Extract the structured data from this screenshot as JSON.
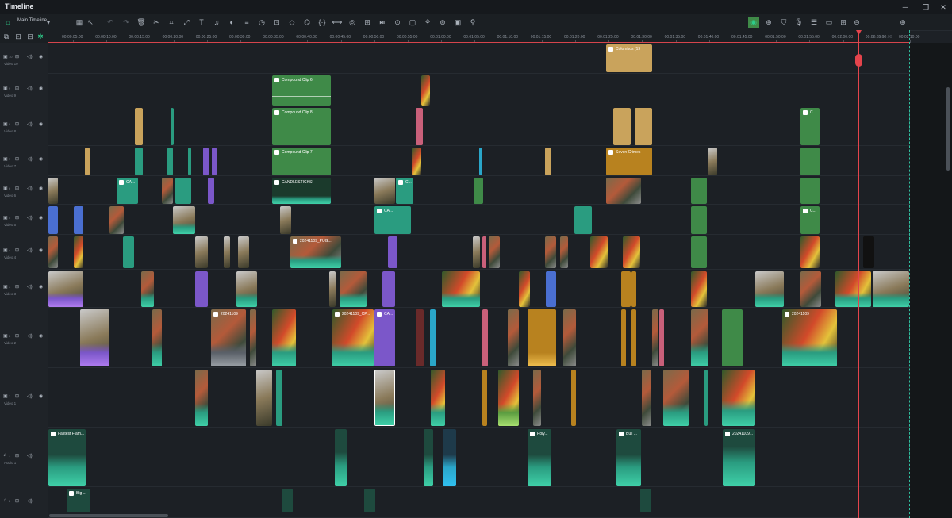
{
  "window": {
    "title": "Timeline"
  },
  "toolbar": {
    "timeline_name": "Main Timeline"
  },
  "ruler": {
    "ticks": [
      "00:00:05:00",
      "00:00:10:00",
      "00:00:15:00",
      "00:00:20:00",
      "00:00:25:00",
      "00:00:30:00",
      "00:00:35:00",
      "00:00:40:00",
      "00:00:45:00",
      "00:00:50:00",
      "00:00:55:00",
      "00:01:00:00",
      "00:01:05:00",
      "00:01:10:00",
      "00:01:15:00",
      "00:01:20:00",
      "00:01:25:00",
      "00:01:30:00",
      "00:01:35:00",
      "00:01:40:00",
      "00:01:45:00",
      "00:01:50:00",
      "00:01:55:00",
      "00:02:00:00",
      "00:02:05:00",
      "00:02:10:00"
    ],
    "end_label": "00:02:15:00"
  },
  "tracks": [
    {
      "num": "10",
      "name": "Video 10"
    },
    {
      "num": "9",
      "name": "Video 9"
    },
    {
      "num": "8",
      "name": "Video 8"
    },
    {
      "num": "7",
      "name": "Video 7"
    },
    {
      "num": "6",
      "name": "Video 6"
    },
    {
      "num": "5",
      "name": "Video 5"
    },
    {
      "num": "4",
      "name": "Video 4"
    },
    {
      "num": "3",
      "name": "Video 3"
    },
    {
      "num": "2",
      "name": "Video 2"
    },
    {
      "num": "1",
      "name": "Video 1"
    },
    {
      "num": "1",
      "name": "Audio 1"
    },
    {
      "num": "2",
      "name": ""
    }
  ],
  "clips": {
    "colombus": "Colombus (19",
    "compound6": "Compound Clip 6",
    "compound8": "Compound Clip 8",
    "compound7": "Compound Clip 7",
    "seven_crimes": "Seven Crimes",
    "candlesticks": "CANDLESTICKS!",
    "ca1": "CA...",
    "c1": "C...",
    "c2": "C...",
    "c3": "C...",
    "date1": "20241109_PUG...",
    "date2": "20241109",
    "date3": "20241109_CP...",
    "date4": "20241109",
    "ca2": "CA...",
    "ca3": "CA...",
    "fastest": "Fastest Flam...",
    "poly": "Poly...",
    "bull": "Bull ...",
    "date5": "20241109...",
    "big": "Big ..."
  }
}
